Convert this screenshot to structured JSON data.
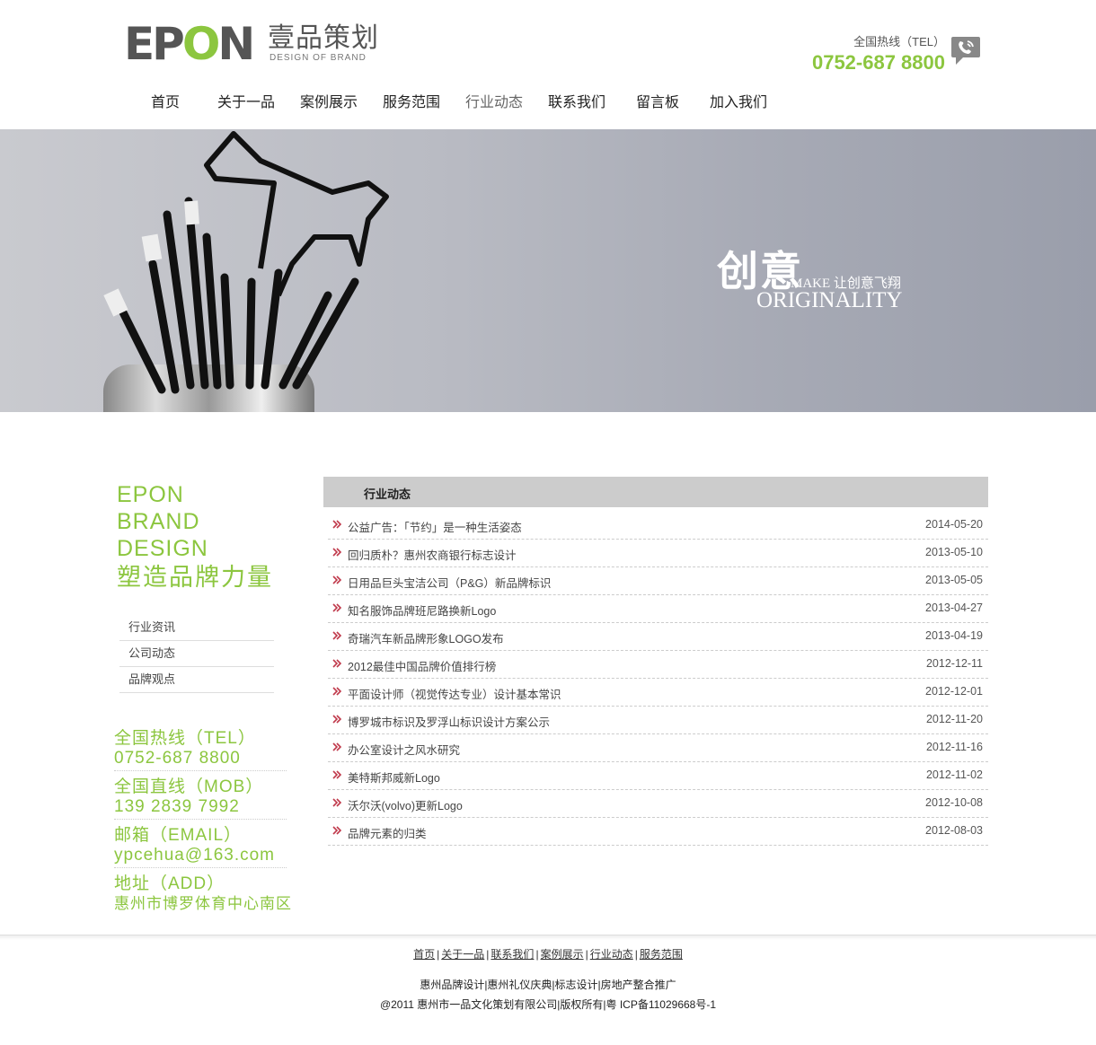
{
  "header": {
    "logo_en_1": "EP",
    "logo_en_2": "O",
    "logo_en_3": "N",
    "logo_cn": "壹品策划",
    "logo_sub": "DESIGN OF BRAND",
    "hotline_label": "全国热线（TEL）",
    "hotline_number": "0752-687 8800"
  },
  "nav": {
    "items": [
      "首页",
      "关于一品",
      "案例展示",
      "服务范围",
      "行业动态",
      "联系我们",
      "留言板",
      "加入我们"
    ],
    "active": "行业动态"
  },
  "banner": {
    "cn": "创意",
    "make": "MAKE 让创意飞翔",
    "originality": "ORIGINALITY"
  },
  "sidebar": {
    "brand": [
      "EPON",
      "BRAND",
      "DESIGN"
    ],
    "slogan": "塑造品牌力量",
    "menu": [
      "行业资讯",
      "公司动态",
      "品牌观点"
    ],
    "contacts": [
      {
        "label": "全国热线（TEL）",
        "value": "0752-687 8800"
      },
      {
        "label": "全国直线（MOB）",
        "value": "139 2839 7992"
      },
      {
        "label": "邮箱（EMAIL）",
        "value": "ypcehua@163.com"
      },
      {
        "label": "地址（ADD）",
        "value": "惠州市博罗体育中心南区"
      }
    ]
  },
  "content": {
    "heading": "行业动态",
    "news": [
      {
        "title": "公益广告：「节约」是一种生活姿态",
        "date": "2014-05-20"
      },
      {
        "title": "回归质朴？惠州农商银行标志设计",
        "date": "2013-05-10"
      },
      {
        "title": "日用品巨头宝洁公司（P&G）新品牌标识",
        "date": "2013-05-05"
      },
      {
        "title": "知名服饰品牌班尼路换新Logo",
        "date": "2013-04-27"
      },
      {
        "title": "奇瑞汽车新品牌形象LOGO发布",
        "date": "2013-04-19"
      },
      {
        "title": "2012最佳中国品牌价值排行榜",
        "date": "2012-12-11"
      },
      {
        "title": "平面设计师（视觉传达专业）设计基本常识",
        "date": "2012-12-01"
      },
      {
        "title": "博罗城市标识及罗浮山标识设计方案公示",
        "date": "2012-11-20"
      },
      {
        "title": "办公室设计之风水研究",
        "date": "2012-11-16"
      },
      {
        "title": "美特斯邦威新Logo",
        "date": "2012-11-02"
      },
      {
        "title": "沃尔沃(volvo)更新Logo",
        "date": "2012-10-08"
      },
      {
        "title": "品牌元素的归类",
        "date": "2012-08-03"
      }
    ]
  },
  "footer": {
    "links": [
      "首页",
      "关于一品",
      "联系我们",
      "案例展示",
      "行业动态",
      "服务范围"
    ],
    "separator": "|",
    "keywords": "惠州品牌设计|惠州礼仪庆典|标志设计|房地产整合推广",
    "copyright": "@2011 惠州市一品文化策划有限公司|版权所有|粤 ICP备11029668号-1"
  },
  "colors": {
    "accent": "#8cc63f",
    "arrow": "#c0394b"
  }
}
